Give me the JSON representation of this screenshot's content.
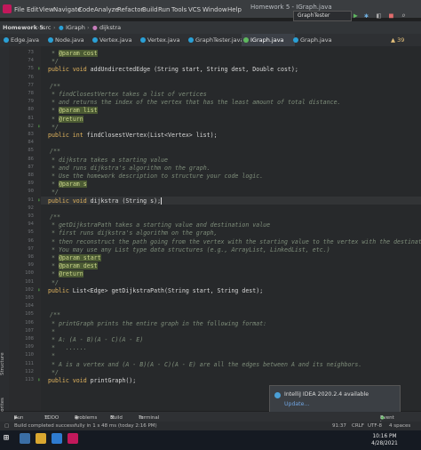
{
  "window": {
    "title": "Homework 5 - IGraph.java"
  },
  "menu": [
    "File",
    "Edit",
    "View",
    "Navigate",
    "Code",
    "Analyze",
    "Refactor",
    "Build",
    "Run",
    "Tools",
    "VCS",
    "Window",
    "Help"
  ],
  "toolbar": {
    "run_config": "GraphTester",
    "run_icon": "play-icon",
    "debug_icon": "bug-icon"
  },
  "breadcrumb": [
    "Homework 5",
    "src",
    "IGraph",
    "dijkstra"
  ],
  "tabs": [
    {
      "label": "Edge.java",
      "active": false
    },
    {
      "label": "Node.java",
      "active": false
    },
    {
      "label": "Vertex.java",
      "active": false
    },
    {
      "label": "Vertex.java",
      "active": false
    },
    {
      "label": "GraphTester.java",
      "active": false
    },
    {
      "label": "IGraph.java",
      "active": true
    },
    {
      "label": "Graph.java",
      "active": false
    }
  ],
  "inspection": {
    "warnings": "39"
  },
  "left_tabs": [
    "Structure",
    "Favorites"
  ],
  "line_numbers": [
    "73",
    "74",
    "75",
    "76",
    "77",
    "78",
    "79",
    "80",
    "81",
    "82",
    "83",
    "84",
    "85",
    "86",
    "87",
    "88",
    "89",
    "90",
    "91",
    "92",
    "93",
    "94",
    "95",
    "96",
    "97",
    "98",
    "99",
    "100",
    "101",
    "102",
    "103",
    "104",
    "105",
    "106",
    "107",
    "108",
    "109",
    "110",
    "111",
    "112",
    "113"
  ],
  "code": {
    "l73a": "* ",
    "l73b": "@param",
    "l73c": " cost",
    "l74": "*/",
    "l75a": "public void ",
    "l75b": "addUndirectedEdge (String start, String dest, Double cost);",
    "l77": "/**",
    "l78": "* findClosestVertex takes a list of vertices",
    "l79": "* and returns the index of the vertex that has the least amount of total distance.",
    "l80a": "* ",
    "l80b": "@param",
    "l80c": " list",
    "l81a": "* ",
    "l81b": "@return",
    "l82": "*/",
    "l83a": "public int ",
    "l83b": "findClosestVertex(List<Vertex> list);",
    "l85": "/**",
    "l86": "* dijkstra takes a starting value",
    "l87": "* and runs dijkstra's algorithm on the graph.",
    "l88": "* Use the homework description to structure your code logic.",
    "l89a": "* ",
    "l89b": "@param",
    "l89c": " s",
    "l90": "*/",
    "l91a": "public void ",
    "l91b": "dijkstra (String s);",
    "l93": "/**",
    "l94": "* getDijkstraPath takes a starting value and destination value",
    "l95": "* first runs dijkstra's algorithm on the graph,",
    "l96": "* then reconstruct the path going from the vertex with the starting value to the vertex with the destination",
    "l97": "* You may use any List type data structures (e.g., ArrayList, LinkedList, etc.)",
    "l98a": "* ",
    "l98b": "@param",
    "l98c": " start",
    "l99a": "* ",
    "l99b": "@param",
    "l99c": " dest",
    "l100a": "* ",
    "l100b": "@return",
    "l101": "*/",
    "l102a": "public ",
    "l102b": "List<Edge> getDijkstraPath(String start, String dest);",
    "l105": "/**",
    "l106": "* printGraph prints the entire graph in the following format:",
    "l107": "*",
    "l108": "* A: (A - B)(A - C)(A - E)",
    "l109": "*   ......",
    "l110": "*",
    "l111": "* A is a vertex and (A - B)(A - C)(A - E) are all the edges between A and its neighbors.",
    "l112": "*/",
    "l113a": "public void ",
    "l113b": "printGraph();"
  },
  "notification": {
    "title": "IntelliJ IDEA 2020.2.4 available",
    "link": "Update..."
  },
  "tool_windows": [
    "Run",
    "TODO",
    "Problems",
    "Build",
    "Terminal",
    "Event Log"
  ],
  "status": {
    "message": "Build completed successfully in 1 s 48 ms (today 2:16 PM)",
    "position": "91:37",
    "line_sep": "CRLF",
    "encoding": "UTF-8",
    "indent": "4 spaces"
  },
  "clock": {
    "time": "10:16 PM",
    "date": "4/28/2021"
  },
  "colors": {
    "keyword": "#e3b55e",
    "doc": "#7e8d7a",
    "editor_bg": "#27292b",
    "accent": "#4a88c7"
  }
}
